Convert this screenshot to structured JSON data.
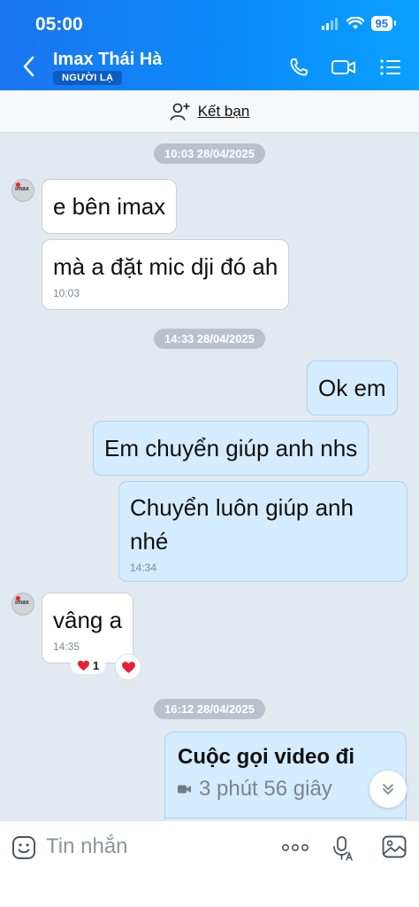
{
  "status_bar": {
    "time": "05:00",
    "battery": "95"
  },
  "header": {
    "contact_name": "Imax Thái Hà",
    "badge": "NGƯỜI LẠ"
  },
  "friend_bar": {
    "label": "Kết bạn"
  },
  "avatar": {
    "text": "imax"
  },
  "messages": [
    {
      "stamp": "10:03 28/04/2025"
    },
    {
      "text": "e bên imax"
    },
    {
      "text": "mà a đặt mic dji đó ah",
      "time": "10:03"
    },
    {
      "stamp": "14:33 28/04/2025"
    },
    {
      "text": "Ok em"
    },
    {
      "text": "Em chuyển giúp anh nhs"
    },
    {
      "text_line1": "Chuyển luôn giúp anh",
      "text_line2": "nhé",
      "time": "14:34"
    },
    {
      "text": "vâng a",
      "time": "14:35",
      "reaction_count": "1"
    },
    {
      "stamp": "16:12 28/04/2025"
    }
  ],
  "call": {
    "title": "Cuộc gọi video đi",
    "duration": "3 phút 56 giây"
  },
  "input": {
    "placeholder": "Tin nhắn"
  },
  "colors": {
    "header_blue": "#0b8dfc",
    "outgoing_bubble": "#d5ecfe",
    "chat_background": "#e2e9f1",
    "heart_red": "#e8203a"
  }
}
